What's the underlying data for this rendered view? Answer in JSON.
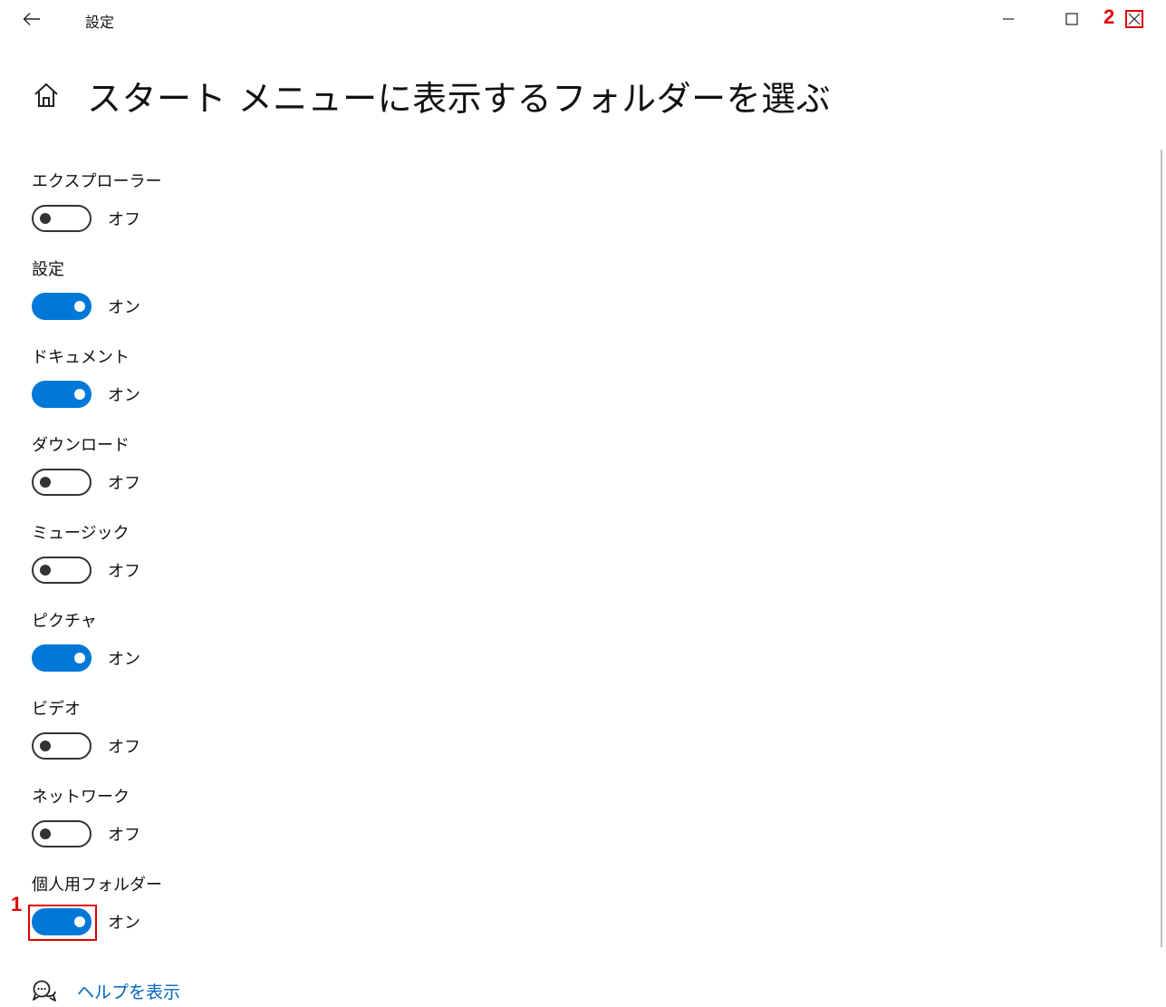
{
  "window": {
    "app_title": "設定",
    "step_labels": {
      "toggle": "1",
      "close": "2"
    }
  },
  "header": {
    "title": "スタート メニューに表示するフォルダーを選ぶ"
  },
  "states": {
    "on": "オン",
    "off": "オフ"
  },
  "settings": [
    {
      "label": "エクスプローラー",
      "on": false,
      "state_text": "オフ"
    },
    {
      "label": "設定",
      "on": true,
      "state_text": "オン"
    },
    {
      "label": "ドキュメント",
      "on": true,
      "state_text": "オン"
    },
    {
      "label": "ダウンロード",
      "on": false,
      "state_text": "オフ"
    },
    {
      "label": "ミュージック",
      "on": false,
      "state_text": "オフ"
    },
    {
      "label": "ピクチャ",
      "on": true,
      "state_text": "オン"
    },
    {
      "label": "ビデオ",
      "on": false,
      "state_text": "オフ"
    },
    {
      "label": "ネットワーク",
      "on": false,
      "state_text": "オフ"
    },
    {
      "label": "個人用フォルダー",
      "on": true,
      "state_text": "オン",
      "highlighted": true
    }
  ],
  "footer": {
    "help_link": "ヘルプを表示"
  },
  "colors": {
    "accent": "#0078d7",
    "annotation": "#e00000",
    "link": "#0067c0"
  }
}
